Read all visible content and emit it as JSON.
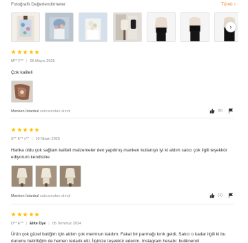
{
  "photo_section": {
    "title": "Fotoğraflı Değerlendirmeler",
    "see_all": "Tümü",
    "thumbnail_count": 7
  },
  "colors": {
    "accent": "#f27a1a",
    "star": "#ffc000",
    "text": "#333333",
    "muted": "#888888"
  },
  "reviews": [
    {
      "rating": 5,
      "author": "M** F**",
      "date": "05 Mayıs 2025",
      "badge": "",
      "text": "Çok kaliteli",
      "photo_count": 1,
      "seller": "Manken İstanbul",
      "seller_suffix": "satıcısından alındı",
      "likes": "(0)"
    },
    {
      "rating": 5,
      "author": "S** K** y**",
      "date": "10 Nisan 2025",
      "badge": "",
      "text": "Harika oldu çok sağlam kaliteli malzemeler den yapılmış manken kullanışlı iyi ki aldım satıcı çok ilgili teşekkür ediyorum kendisine",
      "photo_count": 3,
      "seller": "Manken İstanbul",
      "seller_suffix": "satıcısından alındı",
      "likes": "(1)"
    },
    {
      "rating": 5,
      "author": "D** E**",
      "date": "05 Temmuz 2024",
      "badge": "Elite Üye",
      "text": "Ürün çok güzel butiğim için aldım çok memnun kaldım. Fakat bir parmağı kırık geldi. Satıcı o kadar ilgili ki bu durumu belirttiğim de hemen tedarik etti. İlginize teşekkür ederim. Instagram hesabı: butikneroli"
    }
  ],
  "icons": {
    "next": "chevron-right-icon",
    "like": "thumbs-up-icon",
    "report": "flag-icon",
    "star": "star-icon"
  }
}
